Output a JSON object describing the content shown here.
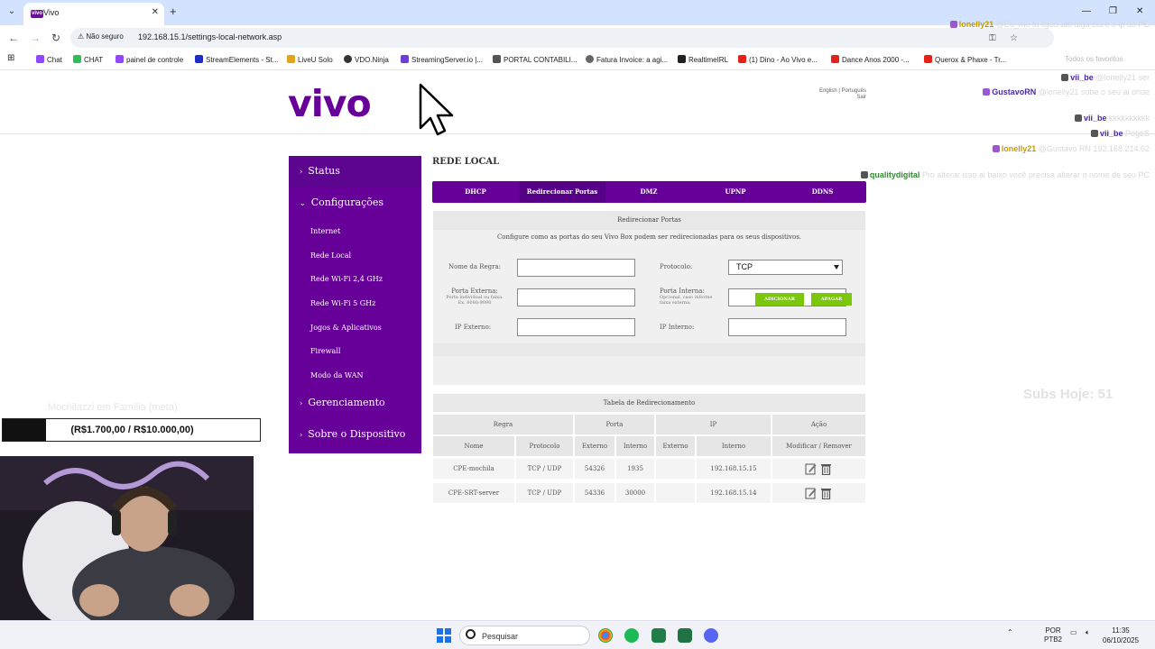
{
  "browser": {
    "tab_title": "Vivo",
    "tab_favicon": "vivo",
    "security_label": "Não seguro",
    "url": "192.168.15.1/settings-local-network.asp",
    "bookmarks": [
      "Chat",
      "CHAT",
      "painel de controle",
      "StreamElements - St...",
      "LiveU Solo",
      "VDO.Ninja",
      "StreamingServer.io |...",
      "PORTAL CONTABILI...",
      "Fatura Invoice: a agi...",
      "RealtimeIRL",
      "(1) Dino - Ao Vivo e...",
      "Dance Anos 2000 -...",
      "Querox & Phaxe - Tr...",
      "Todos os favoritos"
    ]
  },
  "router": {
    "logo": "vivo",
    "lang": "English | Português",
    "logout": "Sair",
    "page_title": "REDE LOCAL",
    "menu": {
      "status": "Status",
      "config": "Configurações",
      "config_items": [
        "Internet",
        "Rede Local",
        "Rede Wi-Fi 2,4 GHz",
        "Rede Wi-Fi 5 GHz",
        "Jogos & Aplicativos",
        "Firewall",
        "Modo da WAN"
      ],
      "gerenciamento": "Gerenciamento",
      "sobre": "Sobre o Dispositivo"
    },
    "tabs": [
      "DHCP",
      "Redirecionar Portas",
      "DMZ",
      "UPNP",
      "DDNS"
    ],
    "active_tab": "Redirecionar Portas",
    "form": {
      "header": "Redirecionar Portas",
      "desc": "Configure como as portas do seu Vivo Box podem ser redirecionadas para os seus dispositivos.",
      "rule_name": "Nome da Regra:",
      "protocol": "Protocolo:",
      "protocol_value": "TCP",
      "ext_port": "Porta Externa:",
      "ext_port_hint": "Porta individual ou faixa. Ex. 8080:9090",
      "int_port": "Porta Interna:",
      "int_port_hint": "Opcional, caso informe faixa externa.",
      "ext_ip": "IP Externo:",
      "int_ip": "IP Interno:",
      "add": "ADICIONAR",
      "delete": "APAGAR"
    },
    "table": {
      "title": "Tabela de Redirecionamento",
      "groups": [
        "Regra",
        "Porta",
        "IP",
        "Ação"
      ],
      "cols": [
        "Nome",
        "Protocolo",
        "Externo",
        "Interno",
        "Externo",
        "Interno",
        "Modificar / Remover"
      ],
      "rows": [
        [
          "CPE-mochila",
          "TCP / UDP",
          "54326",
          "1935",
          "",
          "192.168.15.15"
        ],
        [
          "CPE-SRT-server",
          "TCP / UDP",
          "54336",
          "30000",
          "",
          "192.168.15.14"
        ]
      ]
    }
  },
  "overlay": {
    "chat": [
      {
        "name": "lonelly21",
        "color": "#c49a00",
        "text": "@Eu_me ta ligou ate diga ela e o ip do PC"
      },
      {
        "name": "vii_be",
        "color": "#4a2aa0",
        "text": "@lonelly21 ser"
      },
      {
        "name": "GustavoRN",
        "color": "#4a2aa0",
        "text": "@lonelly21 sobe o seu ai onde"
      },
      {
        "name": "vii_be",
        "color": "#4a2aa0",
        "text": "kkkkkkkkkk"
      },
      {
        "name": "vii_be",
        "color": "#4a2aa0",
        "text": "PogoS"
      },
      {
        "name": "lonelly21",
        "color": "#c49a00",
        "text": "@Gustavo RN 192.168.214.62"
      },
      {
        "name": "qualitydigital",
        "color": "#2e8b2e",
        "text": "Pro alterar isso ai baixo você precisa alterar o nome de seu PC"
      }
    ],
    "subs": "Subs Hoje: 51",
    "family": "Mochilazzi em Família (meta)",
    "goal_text": "(R$1.700,00 / R$10.000,00)",
    "goal_progress": 0.17
  },
  "taskbar": {
    "search": "Pesquisar",
    "lang": "POR",
    "kbd": "PTB2",
    "time": "11:35",
    "date": "06/10/2025"
  }
}
